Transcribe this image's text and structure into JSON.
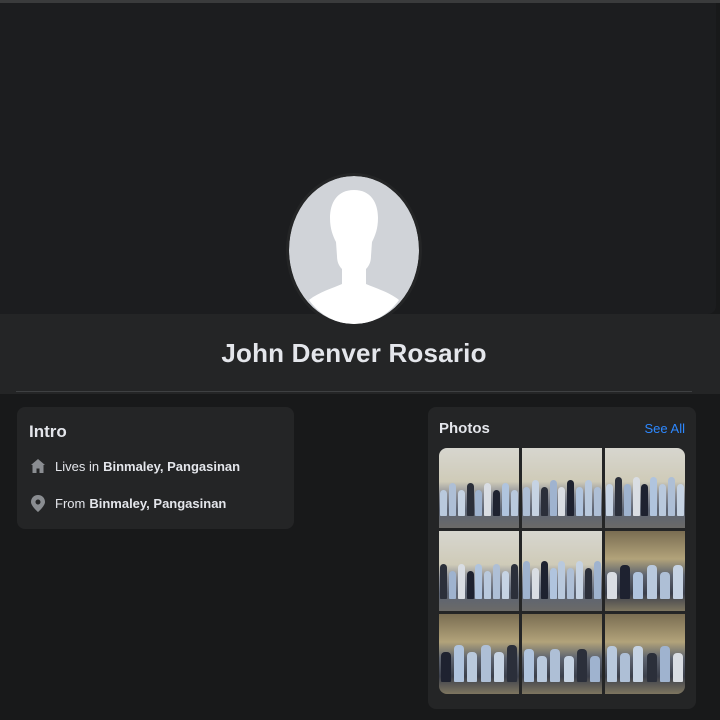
{
  "profile": {
    "name": "John Denver Rosario"
  },
  "intro": {
    "title": "Intro",
    "items": [
      {
        "icon": "home-icon",
        "prefix": "Lives in",
        "value": "Binmaley, Pangasinan"
      },
      {
        "icon": "location-pin-icon",
        "prefix": "From",
        "value": "Binmaley, Pangasinan"
      }
    ]
  },
  "photos": {
    "title": "Photos",
    "see_all_label": "See All",
    "thumbnails": [
      {
        "scene": "hall"
      },
      {
        "scene": "hall"
      },
      {
        "scene": "hall"
      },
      {
        "scene": "hall"
      },
      {
        "scene": "hall"
      },
      {
        "scene": "shade"
      },
      {
        "scene": "shade"
      },
      {
        "scene": "shade"
      },
      {
        "scene": "shade"
      }
    ]
  },
  "colors": {
    "background": "#18191a",
    "card": "#242526",
    "link": "#2d88ff",
    "text": "#e4e6eb"
  }
}
